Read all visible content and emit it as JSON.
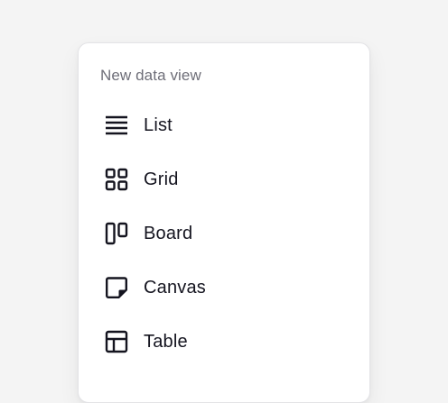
{
  "menu": {
    "heading": "New data view",
    "items": [
      {
        "label": "List",
        "icon": "list-icon"
      },
      {
        "label": "Grid",
        "icon": "grid-icon"
      },
      {
        "label": "Board",
        "icon": "board-icon"
      },
      {
        "label": "Canvas",
        "icon": "canvas-icon"
      },
      {
        "label": "Table",
        "icon": "table-icon"
      }
    ]
  },
  "colors": {
    "background": "#f4f4f4",
    "card": "#ffffff",
    "heading_text": "#6e6e78",
    "item_text": "#14141f",
    "icon": "#14141f"
  }
}
